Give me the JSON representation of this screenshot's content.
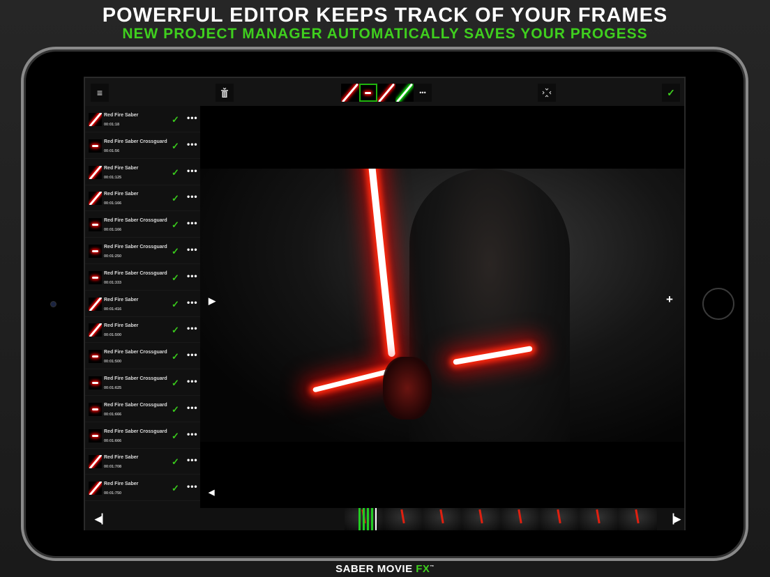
{
  "header": {
    "title": "POWERFUL EDITOR KEEPS TRACK OF YOUR FRAMES",
    "subtitle": "NEW PROJECT MANAGER AUTOMATICALLY SAVES YOUR PROGESS"
  },
  "toolbar": {
    "menu_icon": "≡",
    "more": "•••",
    "confirm": "✓"
  },
  "colors": {
    "accent": "#3fcf1e",
    "saber_red": "#ff2a10"
  },
  "items": [
    {
      "name": "Red Fire Saber",
      "time": "00:01:18",
      "type": "saber"
    },
    {
      "name": "Red Fire Saber Crossguard",
      "time": "00:01:56",
      "type": "cross"
    },
    {
      "name": "Red Fire Saber",
      "time": "00:01:125",
      "type": "saber"
    },
    {
      "name": "Red Fire Saber",
      "time": "00:01:166",
      "type": "saber"
    },
    {
      "name": "Red Fire Saber Crossguard",
      "time": "00:01:166",
      "type": "cross"
    },
    {
      "name": "Red Fire Saber Crossguard",
      "time": "00:01:250",
      "type": "cross"
    },
    {
      "name": "Red Fire Saber Crossguard",
      "time": "00:01:333",
      "type": "cross"
    },
    {
      "name": "Red Fire Saber",
      "time": "00:01:416",
      "type": "saber"
    },
    {
      "name": "Red Fire Saber",
      "time": "00:01:500",
      "type": "saber"
    },
    {
      "name": "Red Fire Saber Crossguard",
      "time": "00:01:500",
      "type": "cross"
    },
    {
      "name": "Red Fire Saber Crossguard",
      "time": "00:01:625",
      "type": "cross"
    },
    {
      "name": "Red Fire Saber Crossguard",
      "time": "00:01:666",
      "type": "cross"
    },
    {
      "name": "Red Fire Saber Crossguard",
      "time": "00:01:666",
      "type": "cross"
    },
    {
      "name": "Red Fire Saber",
      "time": "00:01:708",
      "type": "saber"
    },
    {
      "name": "Red Fire Saber",
      "time": "00:01:750",
      "type": "saber"
    }
  ],
  "item_check": "✓",
  "item_more": "•••",
  "footer": {
    "brand": "SABER MOVIE ",
    "brand_accent": "FX",
    "tm": "™"
  }
}
